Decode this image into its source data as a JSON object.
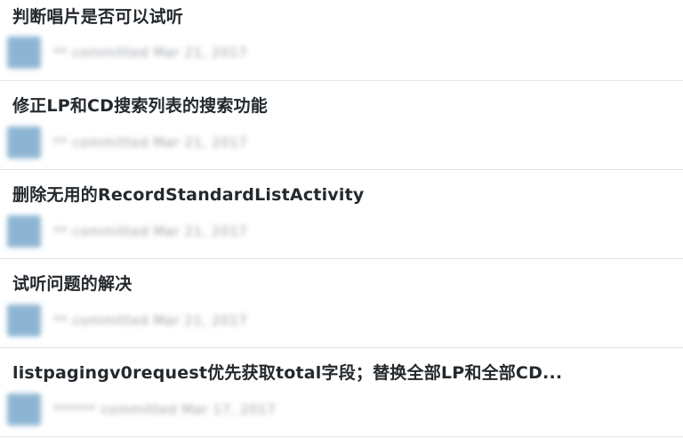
{
  "commits": [
    {
      "title": "判断唱片是否可以试听",
      "meta": "** committed Mar 21, 2017"
    },
    {
      "title": "修正LP和CD搜索列表的搜索功能",
      "meta": "** committed Mar 21, 2017"
    },
    {
      "title": "删除无用的RecordStandardListActivity",
      "meta": "** committed Mar 21, 2017"
    },
    {
      "title": "试听问题的解决",
      "meta": "** committed Mar 21, 2017"
    },
    {
      "title": "listpagingv0request优先获取total字段；替换全部LP和全部CD...",
      "meta": "****** committed Mar 17, 2017"
    }
  ]
}
